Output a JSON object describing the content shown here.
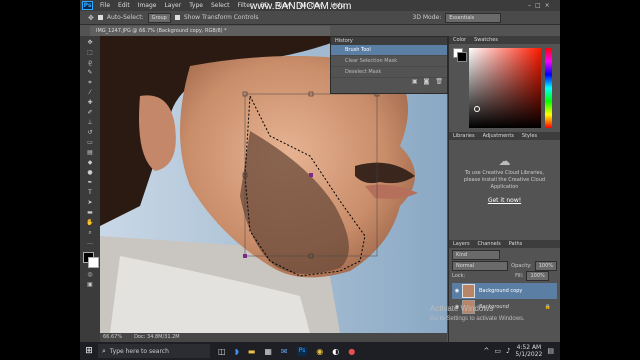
{
  "app": {
    "logo": "Ps",
    "menu": [
      "File",
      "Edit",
      "Image",
      "Layer",
      "Type",
      "Select",
      "Filter",
      "3D",
      "View",
      "Window",
      "Help"
    ]
  },
  "watermark": "www.BANDICAM.com",
  "options_bar": {
    "auto_select_label": "Auto-Select:",
    "auto_select_value": "Group",
    "transform_label": "Show Transform Controls",
    "mode_label": "3D Mode:",
    "workspace": "Essentials"
  },
  "document": {
    "tab": "IMG_1247.JPG @ 66.7% (Background copy, RGB/8) *",
    "zoom": "66.67%",
    "doc_size": "Doc: 34.8M/31.2M"
  },
  "history": {
    "title": "History",
    "items": [
      "Brush Tool",
      "Clear Selection Mask",
      "Deselect Mask"
    ],
    "selected_index": 0
  },
  "color_panel": {
    "tabs": [
      "Color",
      "Swatches"
    ]
  },
  "libraries_panel": {
    "tabs": [
      "Libraries",
      "Adjustments",
      "Styles"
    ],
    "message": "To use Creative Cloud Libraries, please install the Creative Cloud Application",
    "link": "Get it now!"
  },
  "layers_panel": {
    "tabs": [
      "Layers",
      "Channels",
      "Paths"
    ],
    "filter_label": "Kind",
    "blend_mode": "Normal",
    "opacity_label": "Opacity:",
    "opacity": "100%",
    "lock_label": "Lock:",
    "fill_label": "Fill:",
    "fill": "100%",
    "layers": [
      {
        "name": "Background copy",
        "selected": true
      },
      {
        "name": "Background",
        "selected": false
      }
    ]
  },
  "activate_windows": {
    "title": "Activate Windows",
    "sub": "Go to Settings to activate Windows."
  },
  "taskbar": {
    "search_placeholder": "Type here to search",
    "time": "4:52 AM",
    "date": "5/1/2022"
  },
  "colors": {
    "accent": "#5b7ea5",
    "panel": "#535353",
    "ps_blue": "#31a8ff"
  }
}
